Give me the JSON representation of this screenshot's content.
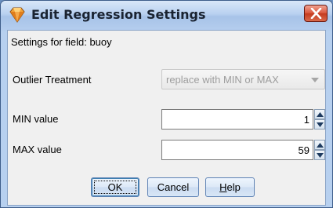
{
  "window": {
    "title": "Edit Regression Settings",
    "icon": "diamond-icon",
    "close_icon": "close-icon"
  },
  "form": {
    "field_label": "Settings for field: buoy",
    "outlier_label": "Outlier Treatment",
    "outlier_value": "replace with MIN or MAX",
    "outlier_enabled": false,
    "min_label": "MIN value",
    "min_value": "1",
    "max_label": "MAX value",
    "max_value": "59"
  },
  "buttons": {
    "ok": "OK",
    "cancel": "Cancel",
    "help_mnemonic": "H",
    "help_rest": "elp"
  },
  "colors": {
    "title_bar": "#b9d1f0",
    "close_button": "#d9573e",
    "dialog_background": "#f0f0f0"
  }
}
